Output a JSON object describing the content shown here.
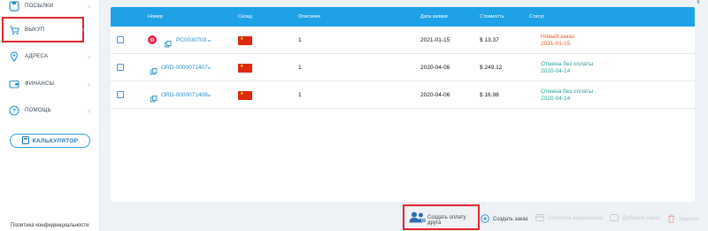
{
  "sidebar": {
    "items": [
      {
        "label": "ПОСЫЛКИ",
        "icon": "box-icon"
      },
      {
        "label": "ВЫКУП",
        "icon": "cart-icon"
      },
      {
        "label": "АДРЕСА",
        "icon": "location-pin-icon"
      },
      {
        "label": "ФИНАНСЫ",
        "icon": "wallet-icon"
      },
      {
        "label": "ПОМОЩЬ",
        "icon": "question-icon"
      }
    ],
    "calculator_label": "КАЛЬКУЛЯТОР",
    "privacy_label": "Политика конфиденциальности"
  },
  "table": {
    "headers": {
      "number": "Номер",
      "warehouse": "Склад",
      "description": "Описание",
      "date": "Дата заявки",
      "cost": "Стоимость",
      "status": "Статус"
    },
    "rows": [
      {
        "number": "PC0030703",
        "warehouse_flag": "china-flag",
        "description": "1",
        "date": "2021-01-15",
        "cost": "$ 13.37",
        "status": "Новый заказ",
        "status_date": "2021-01-15",
        "status_color": "#f05a28"
      },
      {
        "number": "ORD-0000071407",
        "warehouse_flag": "china-flag",
        "description": "1",
        "date": "2020-04-06",
        "cost": "$ 249.12",
        "status": "Отмена без оплаты",
        "status_date": "2020-04-14",
        "status_color": "#27a59a"
      },
      {
        "number": "ORD-0000071408",
        "warehouse_flag": "china-flag",
        "description": "1",
        "date": "2020-04-06",
        "cost": "$ 16.98",
        "status": "Отмена без оплаты",
        "status_date": "2020-04-14",
        "status_color": "#27a59a"
      }
    ]
  },
  "toolbar": {
    "create_friend_payment": "Создать оплату друга",
    "create_order": "Создать заказ",
    "disabled_1": "Оплатить выделенное",
    "disabled_2": "Добавить пакет",
    "delete": "Удалить"
  },
  "colors": {
    "header_blue": "#1ea1e6",
    "link_blue": "#2a8fc9",
    "highlight_red": "#e0262c"
  }
}
